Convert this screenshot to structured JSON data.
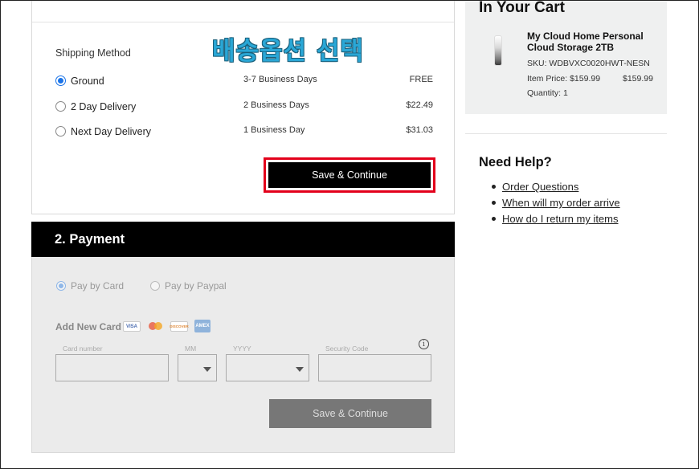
{
  "shipping": {
    "annotation": "배송옵션 선택",
    "title": "Shipping Method",
    "options": [
      {
        "name": "Ground",
        "days": "3-7 Business Days",
        "price": "FREE",
        "selected": true
      },
      {
        "name": "2 Day Delivery",
        "days": "2 Business Days",
        "price": "$22.49",
        "selected": false
      },
      {
        "name": "Next Day Delivery",
        "days": "1 Business Day",
        "price": "$31.03",
        "selected": false
      }
    ],
    "save_label": "Save & Continue",
    "highlight_color": "#e3001b"
  },
  "payment": {
    "header": "2. Payment",
    "methods": [
      {
        "label": "Pay by Card",
        "selected": true
      },
      {
        "label": "Pay by Paypal",
        "selected": false
      }
    ],
    "add_card_label": "Add New Card",
    "card_logos": [
      "visa-icon",
      "mastercard-icon",
      "discover-icon",
      "amex-icon"
    ],
    "logo_text": {
      "visa": "VISA",
      "discover": "DISCOVER",
      "amex": "AMEX"
    },
    "fields": {
      "card_number": "Card number",
      "month": "MM",
      "year": "YYYY",
      "security_code": "Security Code"
    },
    "info_glyph": "i",
    "save_label": "Save & Continue"
  },
  "cart": {
    "title": "In Your Cart",
    "product": {
      "name": "My Cloud Home Personal Cloud Storage 2TB",
      "sku": "SKU: WDBVXC0020HWT-NESN",
      "item_price": "Item Price: $159.99",
      "total": "$159.99",
      "quantity": "Quantity: 1"
    }
  },
  "help": {
    "title": "Need Help?",
    "links": [
      "Order Questions",
      "When will my order arrive",
      "How do I return my items"
    ]
  }
}
